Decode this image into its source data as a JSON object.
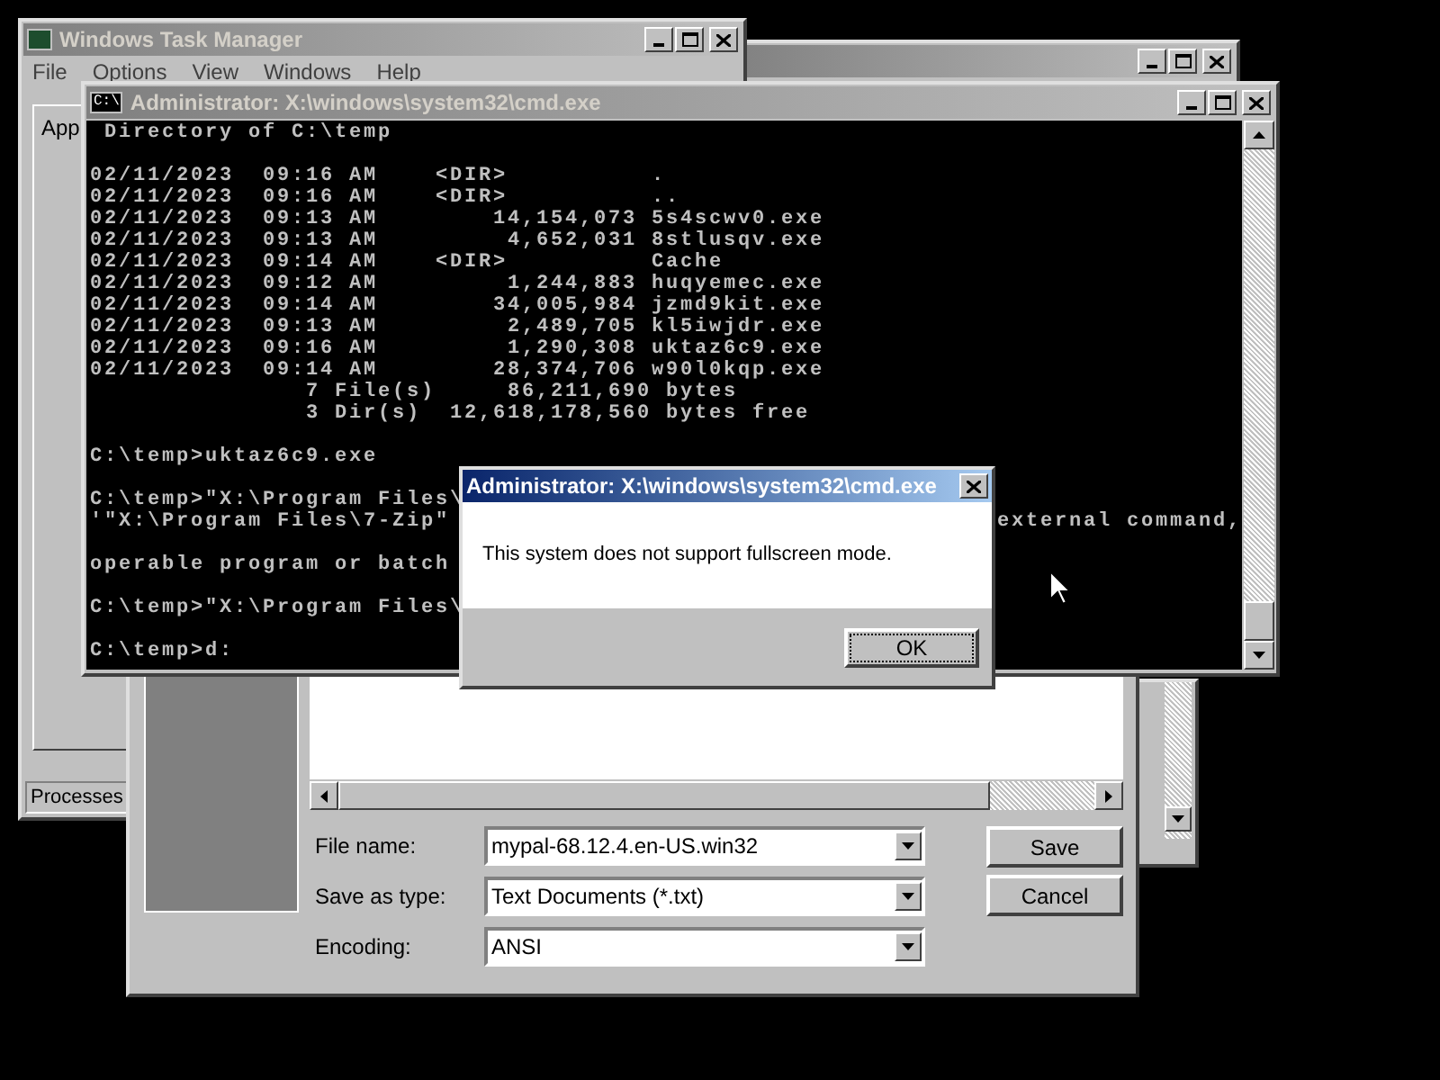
{
  "task_manager": {
    "title": "Windows Task Manager",
    "menu": [
      "File",
      "Options",
      "View",
      "Windows",
      "Help"
    ],
    "tabs": [
      {
        "label": "App",
        "selected": true
      }
    ],
    "status_bar": "Processes"
  },
  "save_dialog": {
    "fields": [
      {
        "label": "File name:",
        "value": "mypal-68.12.4.en-US.win32"
      },
      {
        "label": "Save as type:",
        "value": "Text Documents (*.txt)"
      },
      {
        "label": "Encoding:",
        "value": "ANSI"
      }
    ],
    "buttons": [
      "Save",
      "Cancel"
    ]
  },
  "console": {
    "title": "Administrator: X:\\windows\\system32\\cmd.exe",
    "icon_text": "C:\\",
    "lines": [
      {
        "text": " Directory of C:\\temp"
      },
      {
        "text": "02/11/2023  09:16 AM    <DIR>          .",
        "blank_before": true
      },
      {
        "text": "02/11/2023  09:16 AM    <DIR>          .."
      },
      {
        "text": "02/11/2023  09:13 AM        14,154,073 5s4scwv0.exe"
      },
      {
        "text": "02/11/2023  09:13 AM         4,652,031 8stlusqv.exe"
      },
      {
        "text": "02/11/2023  09:14 AM    <DIR>          Cache"
      },
      {
        "text": "02/11/2023  09:12 AM         1,244,883 huqyemec.exe"
      },
      {
        "text": "02/11/2023  09:14 AM        34,005,984 jzmd9kit.exe"
      },
      {
        "text": "02/11/2023  09:13 AM         2,489,705 kl5iwjdr.exe"
      },
      {
        "text": "02/11/2023  09:16 AM         1,290,308 uktaz6c9.exe"
      },
      {
        "text": "02/11/2023  09:14 AM        28,374,706 w90l0kqp.exe"
      },
      {
        "text": "               7 File(s)     86,211,690 bytes"
      },
      {
        "text": "               3 Dir(s)  12,618,178,560 bytes free"
      },
      {
        "text": "C:\\temp>uktaz6c9.exe",
        "blank_before": true
      },
      {
        "text": "C:\\temp>\"X:\\Program Files\\",
        "blank_before": true
      },
      {
        "text": "'\"X:\\Program Files\\7-Zip\"",
        "tail": "external command,"
      },
      {
        "text": "operable program or batch",
        "blank_before": true
      },
      {
        "text": "C:\\temp>\"X:\\Program Files\\",
        "blank_before": true
      },
      {
        "text": "C:\\temp>d:",
        "blank_before": true
      }
    ]
  },
  "message_box": {
    "title": "Administrator: X:\\windows\\system32\\cmd.exe",
    "message": "This system does not support fullscreen mode.",
    "buttons": [
      "OK"
    ]
  }
}
